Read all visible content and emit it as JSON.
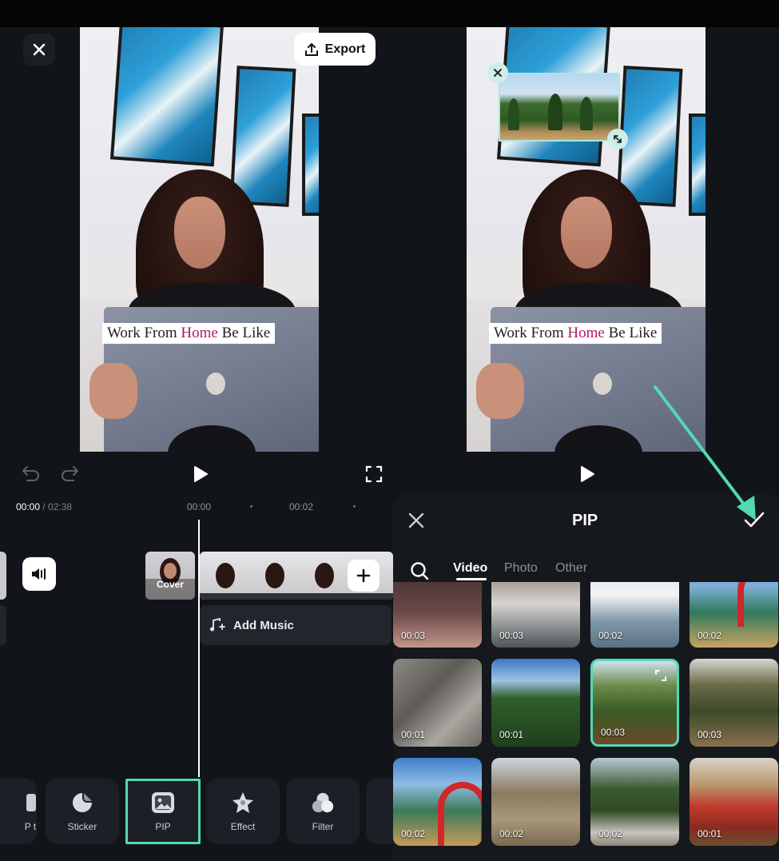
{
  "editor": {
    "export_label": "Export",
    "caption_before": "Work From ",
    "caption_highlight": "Home",
    "caption_after": " Be Like"
  },
  "timeline": {
    "current_time": "00:00",
    "separator": " / ",
    "total_time": "02:38",
    "ruler_marks": [
      "00:00",
      "00:02"
    ],
    "cover_label": "Cover",
    "add_music_label": "Add Music"
  },
  "toolbar": {
    "items": [
      {
        "label": "P t"
      },
      {
        "label": "Sticker"
      },
      {
        "label": "PIP"
      },
      {
        "label": "Effect"
      },
      {
        "label": "Filter"
      }
    ]
  },
  "pip": {
    "title": "PIP",
    "tabs": [
      "Video",
      "Photo",
      "Other"
    ],
    "active_tab": "Video",
    "grid": [
      {
        "duration": "00:03",
        "theme": "person"
      },
      {
        "duration": "00:03",
        "theme": "snow"
      },
      {
        "duration": "00:02",
        "theme": "sky"
      },
      {
        "duration": "00:02",
        "theme": "arch"
      },
      {
        "duration": "00:01",
        "theme": "rock"
      },
      {
        "duration": "00:01",
        "theme": "forest"
      },
      {
        "duration": "00:03",
        "theme": "forest",
        "selected": true
      },
      {
        "duration": "00:03",
        "theme": "woods"
      },
      {
        "duration": "00:02",
        "theme": "arch"
      },
      {
        "duration": "00:02",
        "theme": "woods"
      },
      {
        "duration": "00:02",
        "theme": "snowforest"
      },
      {
        "duration": "00:01",
        "theme": "bench"
      }
    ]
  },
  "colors": {
    "accent": "#54d8b4",
    "bg": "#111419",
    "caption_highlight": "#b2186a"
  }
}
